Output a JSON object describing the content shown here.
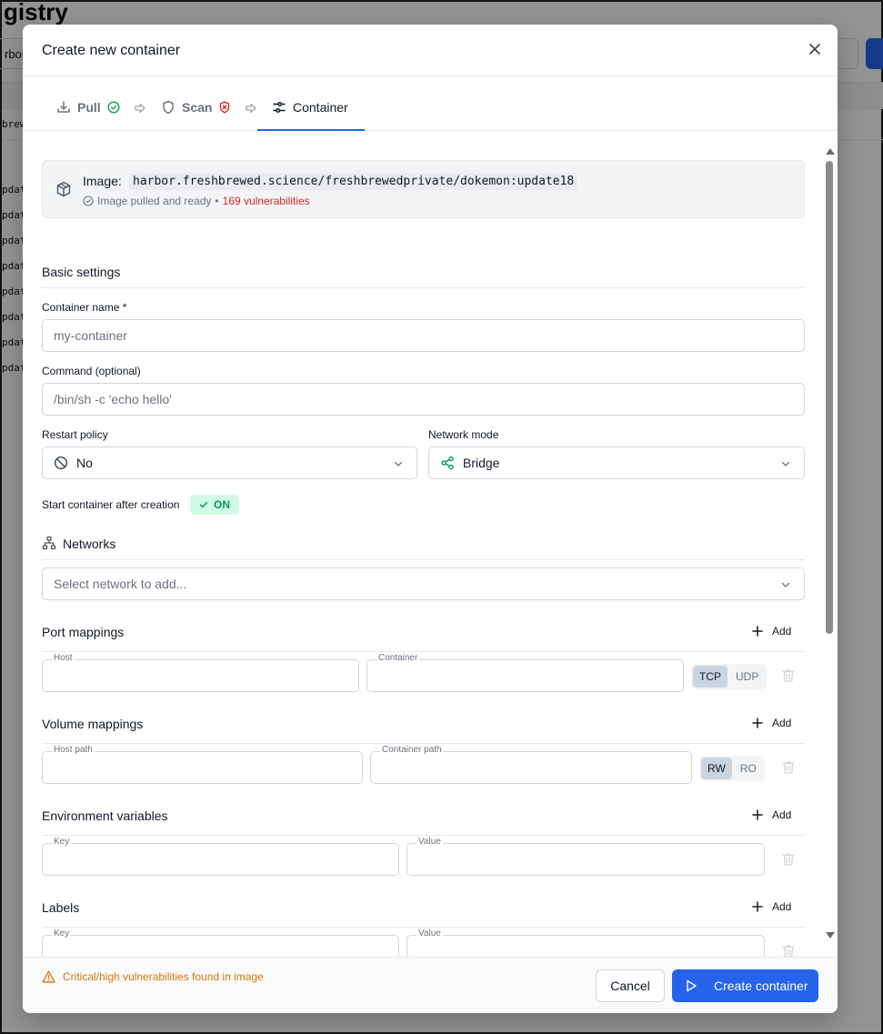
{
  "background": {
    "title": "gistry",
    "search_value": "rbor",
    "first_row": "brew",
    "rows": [
      "pdat",
      "pdat",
      "pdat",
      "pdat",
      "pdat",
      "pdat",
      "pdat",
      "pdat"
    ]
  },
  "modal": {
    "title": "Create new container",
    "tabs": [
      {
        "label": "Pull",
        "status": "ok"
      },
      {
        "label": "Scan",
        "status": "error"
      },
      {
        "label": "Container",
        "status": "active"
      }
    ],
    "image": {
      "label": "Image:",
      "ref": "harbor.freshbrewed.science/freshbrewedprivate/dokemon:update18",
      "status": "Image pulled and ready",
      "separator": "•",
      "vulnerabilities": "169 vulnerabilities"
    },
    "basic": {
      "title": "Basic settings",
      "container_name_label": "Container name *",
      "container_name_placeholder": "my-container",
      "command_label": "Command (optional)",
      "command_placeholder": "/bin/sh -c 'echo hello'",
      "restart_label": "Restart policy",
      "restart_value": "No",
      "network_mode_label": "Network mode",
      "network_mode_value": "Bridge",
      "start_label": "Start container after creation",
      "start_toggle": "ON"
    },
    "networks": {
      "title": "Networks",
      "select_placeholder": "Select network to add..."
    },
    "ports": {
      "title": "Port mappings",
      "add_label": "Add",
      "host_label": "Host",
      "container_label": "Container",
      "protocols": [
        "TCP",
        "UDP"
      ],
      "selected": "TCP"
    },
    "volumes": {
      "title": "Volume mappings",
      "add_label": "Add",
      "host_label": "Host path",
      "container_label": "Container path",
      "modes": [
        "RW",
        "RO"
      ],
      "selected": "RW"
    },
    "env": {
      "title": "Environment variables",
      "add_label": "Add",
      "key_label": "Key",
      "value_label": "Value"
    },
    "labels": {
      "title": "Labels",
      "add_label": "Add",
      "key_label": "Key",
      "value_label": "Value"
    },
    "footer": {
      "warning": "Critical/high vulnerabilities found in image",
      "cancel_label": "Cancel",
      "create_label": "Create container"
    }
  },
  "colors": {
    "accent": "#2563eb",
    "success": "#16a34a",
    "danger": "#dc2626",
    "warning": "#d97706"
  }
}
